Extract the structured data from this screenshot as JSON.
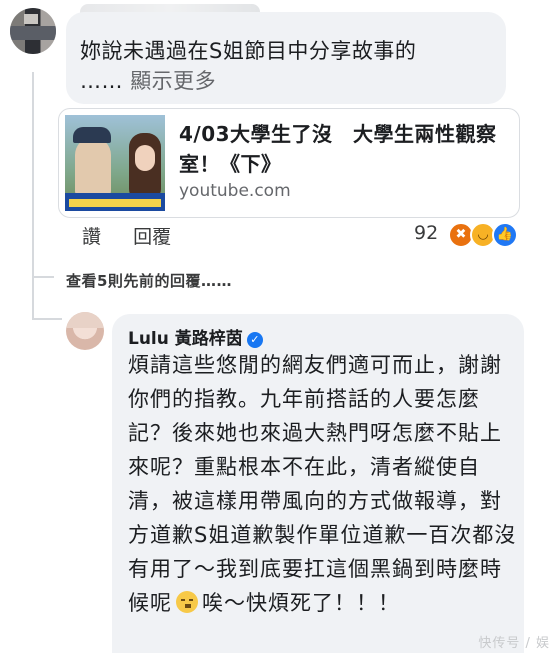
{
  "top_comment": {
    "text_line1": "妳說未遇過在S姐節目中分享故事的",
    "text_line2_prefix": "……",
    "see_more": "顯示更多"
  },
  "link_preview": {
    "title": "4/03大學生了沒　大學生兩性觀察室！《下》",
    "domain": "youtube.com"
  },
  "actions": {
    "like": "讚",
    "reply": "回覆",
    "reaction_count": "92",
    "reaction_icons": [
      "angry-icon",
      "haha-icon",
      "like-icon"
    ]
  },
  "view_previous": "查看5則先前的回覆……",
  "reply": {
    "author": "Lulu 黃路梓茵",
    "text_before_emoji": "煩請這些悠閒的網友們適可而止，謝謝你們的指教。九年前搭話的人要怎麼記？後來她也來過大熱門呀怎麼不貼上來呢？重點根本不在此，清者縱使自清，被這樣用帶風向的方式做報導，對方道歉S姐道歉製作單位道歉一百次都沒有用了～我到底要扛這個黑鍋到時麼時候呢",
    "text_after_emoji": "唉～快煩死了！！！"
  },
  "watermark": "快传号 / 娱"
}
